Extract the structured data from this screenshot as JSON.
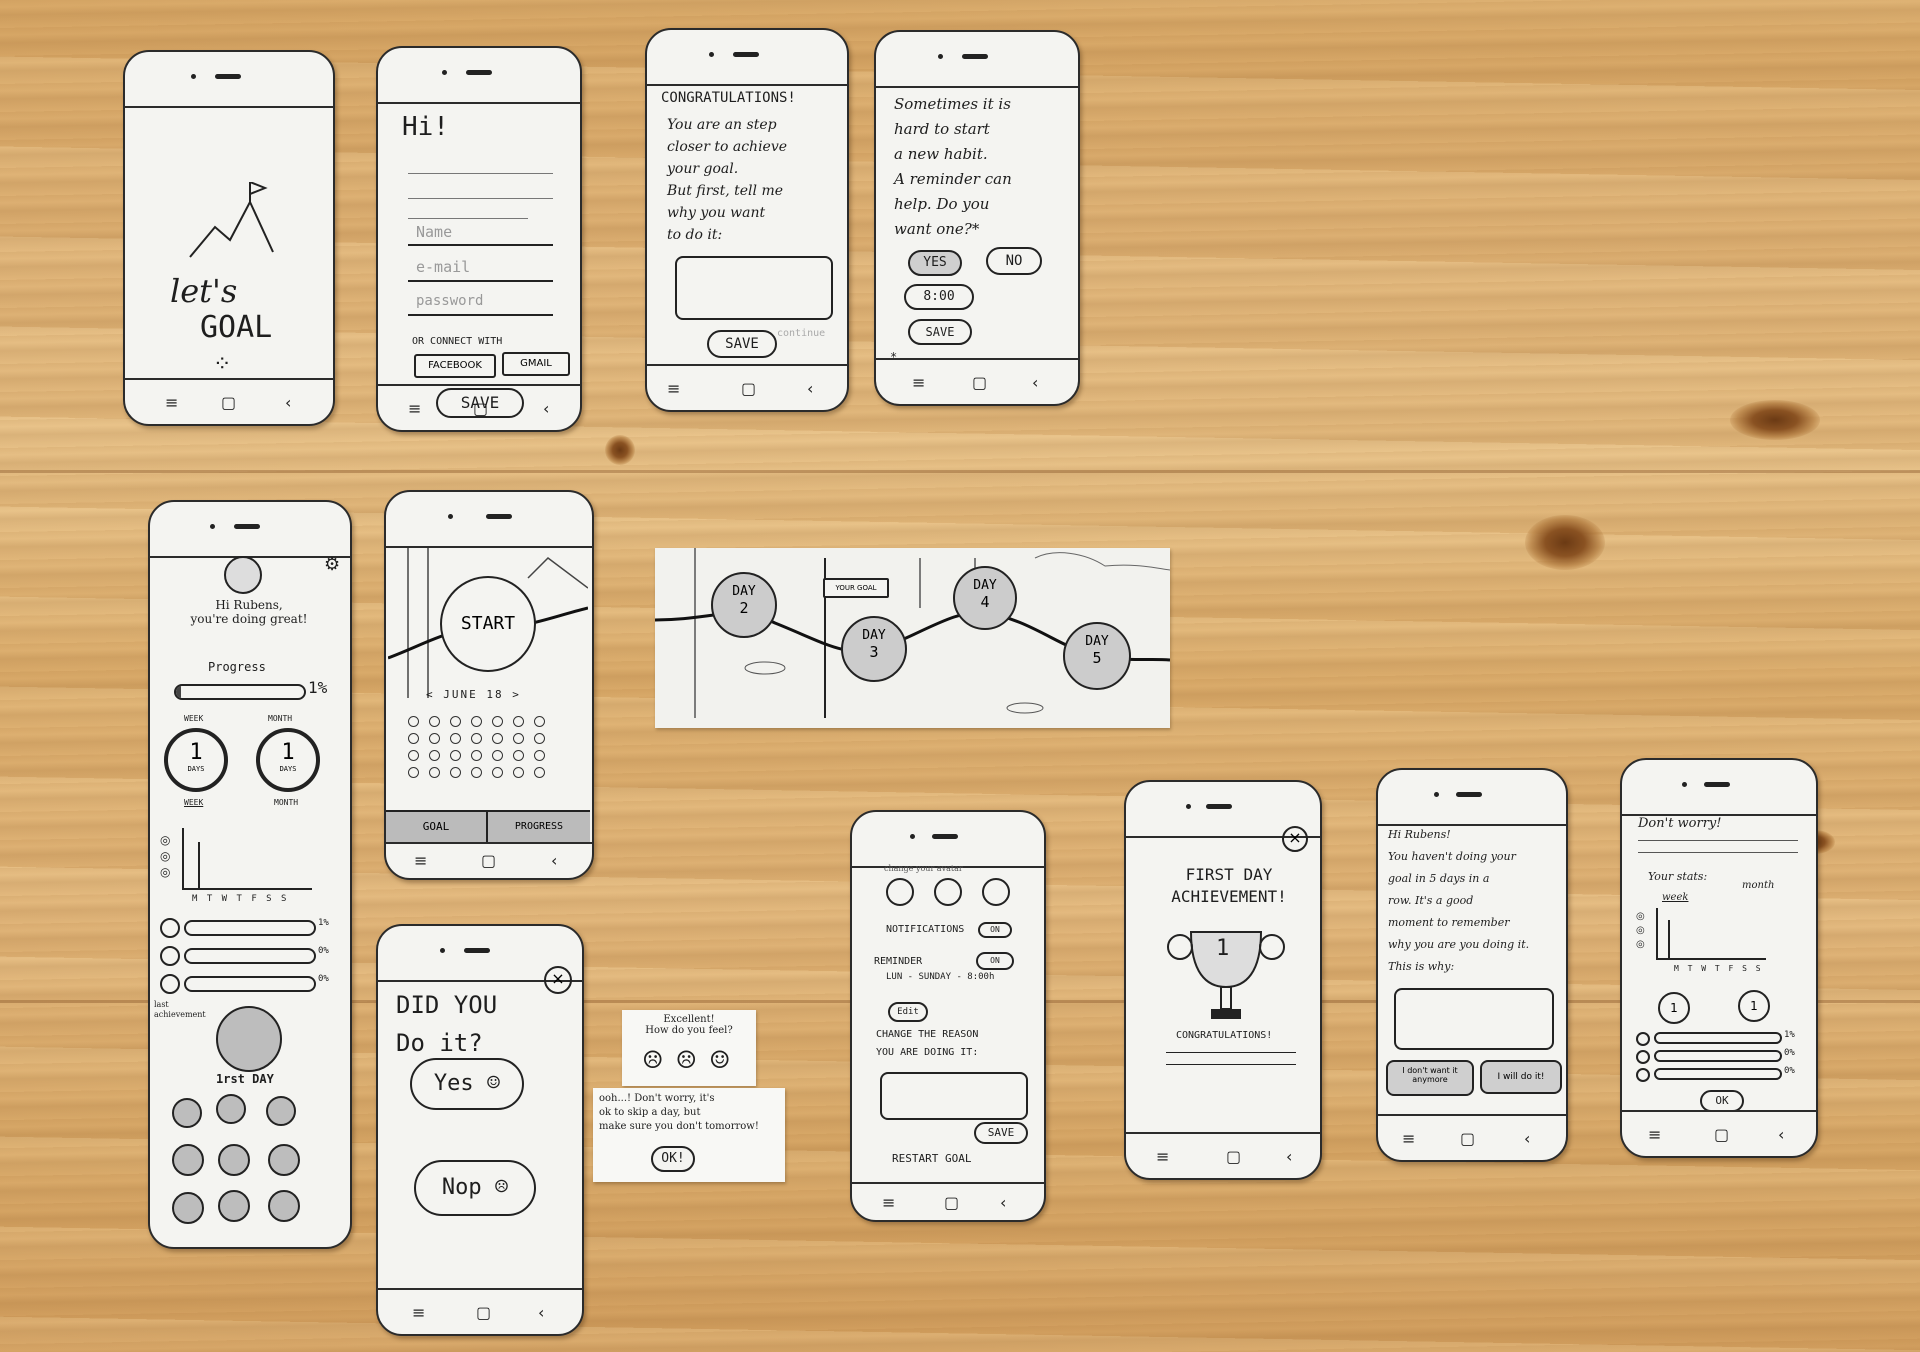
{
  "screens": {
    "splash": {
      "title_line1": "let's",
      "title_line2": "GOAL"
    },
    "signup": {
      "greeting": "Hi!",
      "name_label": "Name",
      "email_label": "e-mail",
      "password_label": "password",
      "connect_label": "OR CONNECT WITH",
      "facebook_button": "FACEBOOK",
      "gmail_button": "GMAIL",
      "save_button": "SAVE"
    },
    "congratulations": {
      "heading": "CONGRATULATIONS!",
      "body": "You are an step\ncloser to achieve\nyour goal.\nBut first, tell me\nwhy you want\nto do it:",
      "save_button": "SAVE",
      "continue_link": "continue"
    },
    "reminder": {
      "body": "Sometimes it is\nhard to start\na new habit.\nA reminder can\nhelp. Do you\nwant one?*",
      "yes_button": "YES",
      "no_button": "NO",
      "time_value": "8:00",
      "save_button": "SAVE",
      "footnote_mark": "*"
    },
    "dashboard": {
      "greeting": "Hi Rubens,\nyou're doing great!",
      "progress_label": "Progress",
      "progress_value": "1%",
      "progress_fraction": 0.01,
      "week_label": "WEEK",
      "month_label": "MONTH",
      "week_days_count": "1",
      "month_days_count": "1",
      "days_unit": "DAYS",
      "tab_week": "WEEK",
      "tab_month": "MONTH",
      "weekday_axis": "M T W T F S S",
      "stat_rows": [
        "1%",
        "0%",
        "0%"
      ],
      "last_achievement_label": "last\nachievement",
      "achievement_name": "1rst DAY"
    },
    "start": {
      "start_button": "START",
      "month_nav": "< JUNE 18 >",
      "tab_goal": "GOAL",
      "tab_progress": "PROGRESS"
    },
    "path_map": {
      "sign": "YOUR GOAL",
      "days": [
        {
          "label": "DAY",
          "num": "2"
        },
        {
          "label": "DAY",
          "num": "3"
        },
        {
          "label": "DAY",
          "num": "4"
        },
        {
          "label": "DAY",
          "num": "5"
        }
      ]
    },
    "did_you_do_it": {
      "question": "DID YOU\nDo it?",
      "yes_button": "Yes",
      "no_button": "Nop"
    },
    "feedback_notes": {
      "excellent_note": "Excellent!\nHow do you feel?",
      "dont_worry_note": "ooh...! Don't worry, it's\nok to skip a day, but\nmake sure you don't tomorrow!",
      "ok_button": "OK!"
    },
    "settings": {
      "avatar_label": "change your avatar",
      "notifications_label": "NOTIFICATIONS",
      "notifications_toggle": "ON",
      "reminder_label": "REMINDER",
      "reminder_toggle": "ON",
      "reminder_schedule": "LUN - SUNDAY - 8:00h",
      "edit_button": "Edit",
      "change_reason_label": "CHANGE THE REASON\nYOU ARE DOING IT:",
      "save_button": "SAVE",
      "restart_button": "RESTART GOAL"
    },
    "achievement": {
      "title": "FIRST DAY\nACHIEVEMENT!",
      "trophy_number": "1",
      "footer": "CONGRATULATIONS!",
      "close_icon": "close-icon"
    },
    "missed_days": {
      "body": "Hi Rubens!\nYou haven't doing your\ngoal in 5 days in a\nrow. It's a good\nmoment to remember\nwhy you are you doing it.\nThis is why:",
      "quit_button": "I don't want\nit anymore",
      "continue_button": "I will do it!"
    },
    "dont_worry": {
      "heading": "Don't worry!",
      "stats_label": "Your stats:",
      "tab_week": "week",
      "tab_month": "month",
      "weekday_axis": "M T W T F S S",
      "week_count": "1",
      "month_count": "1",
      "stat_rows": [
        "1%",
        "0%",
        "0%"
      ],
      "ok_button": "OK"
    }
  }
}
